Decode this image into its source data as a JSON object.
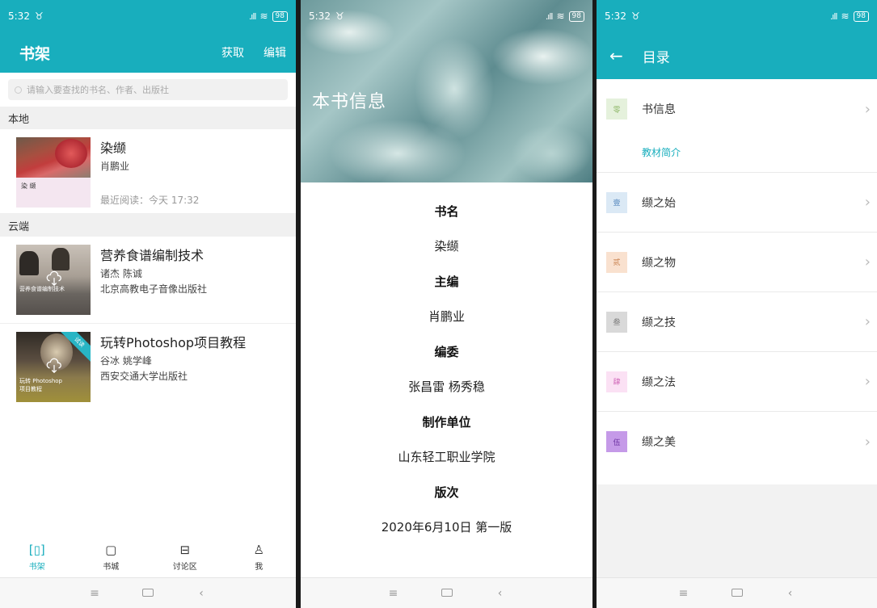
{
  "status": {
    "time": "5:32",
    "battery": "98"
  },
  "shelf": {
    "title": "书架",
    "actions": [
      "获取",
      "编辑"
    ],
    "search_placeholder": "请输入要查找的书名、作者、出版社",
    "local_header": "本地",
    "cloud_header": "云端",
    "local_book": {
      "title": "染缬",
      "author": "肖鹏业",
      "recent": "最近阅读：今天 17:32",
      "cover_title": "染 缬"
    },
    "cloud_books": [
      {
        "title": "营养食谱编制技术",
        "authors": "诸杰 陈诚",
        "publisher": "北京高教电子音像出版社",
        "cover_text": "营养食谱编制技术"
      },
      {
        "title": "玩转Photoshop项目教程",
        "authors": "谷冰 姚学峰",
        "publisher": "西安交通大学出版社",
        "cover_text": "玩转 Photoshop 项目教程",
        "ribbon": "试读"
      }
    ],
    "tabs": [
      {
        "label": "书架",
        "icon": "bookshelf-icon",
        "active": true
      },
      {
        "label": "书城",
        "icon": "bookstore-icon",
        "active": false
      },
      {
        "label": "讨论区",
        "icon": "discussion-icon",
        "active": false
      },
      {
        "label": "我",
        "icon": "profile-icon",
        "active": false
      }
    ]
  },
  "info": {
    "hero_title": "本书信息",
    "fields": [
      {
        "label": "书名",
        "value": "染缬"
      },
      {
        "label": "主编",
        "value": "肖鹏业"
      },
      {
        "label": "编委",
        "value": "张昌雷  杨秀稳"
      },
      {
        "label": "制作单位",
        "value": "山东轻工职业学院"
      },
      {
        "label": "版次",
        "value": "2020年6月10日 第一版"
      }
    ]
  },
  "toc": {
    "title": "目录",
    "book_info": {
      "badge": "零",
      "label": "书信息",
      "sub": "教材简介",
      "badge_color": "#e5f1dc",
      "text_color": "#8fb86a"
    },
    "chapters": [
      {
        "badge": "壹",
        "label": "缬之始",
        "badge_color": "#dbe9f5",
        "text_color": "#5a8ac0"
      },
      {
        "badge": "贰",
        "label": "缬之物",
        "badge_color": "#f9e1cf",
        "text_color": "#c98250"
      },
      {
        "badge": "叁",
        "label": "缬之技",
        "badge_color": "#d9d9d9",
        "text_color": "#777777"
      },
      {
        "badge": "肆",
        "label": "缬之法",
        "badge_color": "#fbe1f4",
        "text_color": "#d068b8"
      },
      {
        "badge": "伍",
        "label": "缬之美",
        "badge_color": "#c59ae8",
        "text_color": "#6a2fa0"
      }
    ]
  }
}
